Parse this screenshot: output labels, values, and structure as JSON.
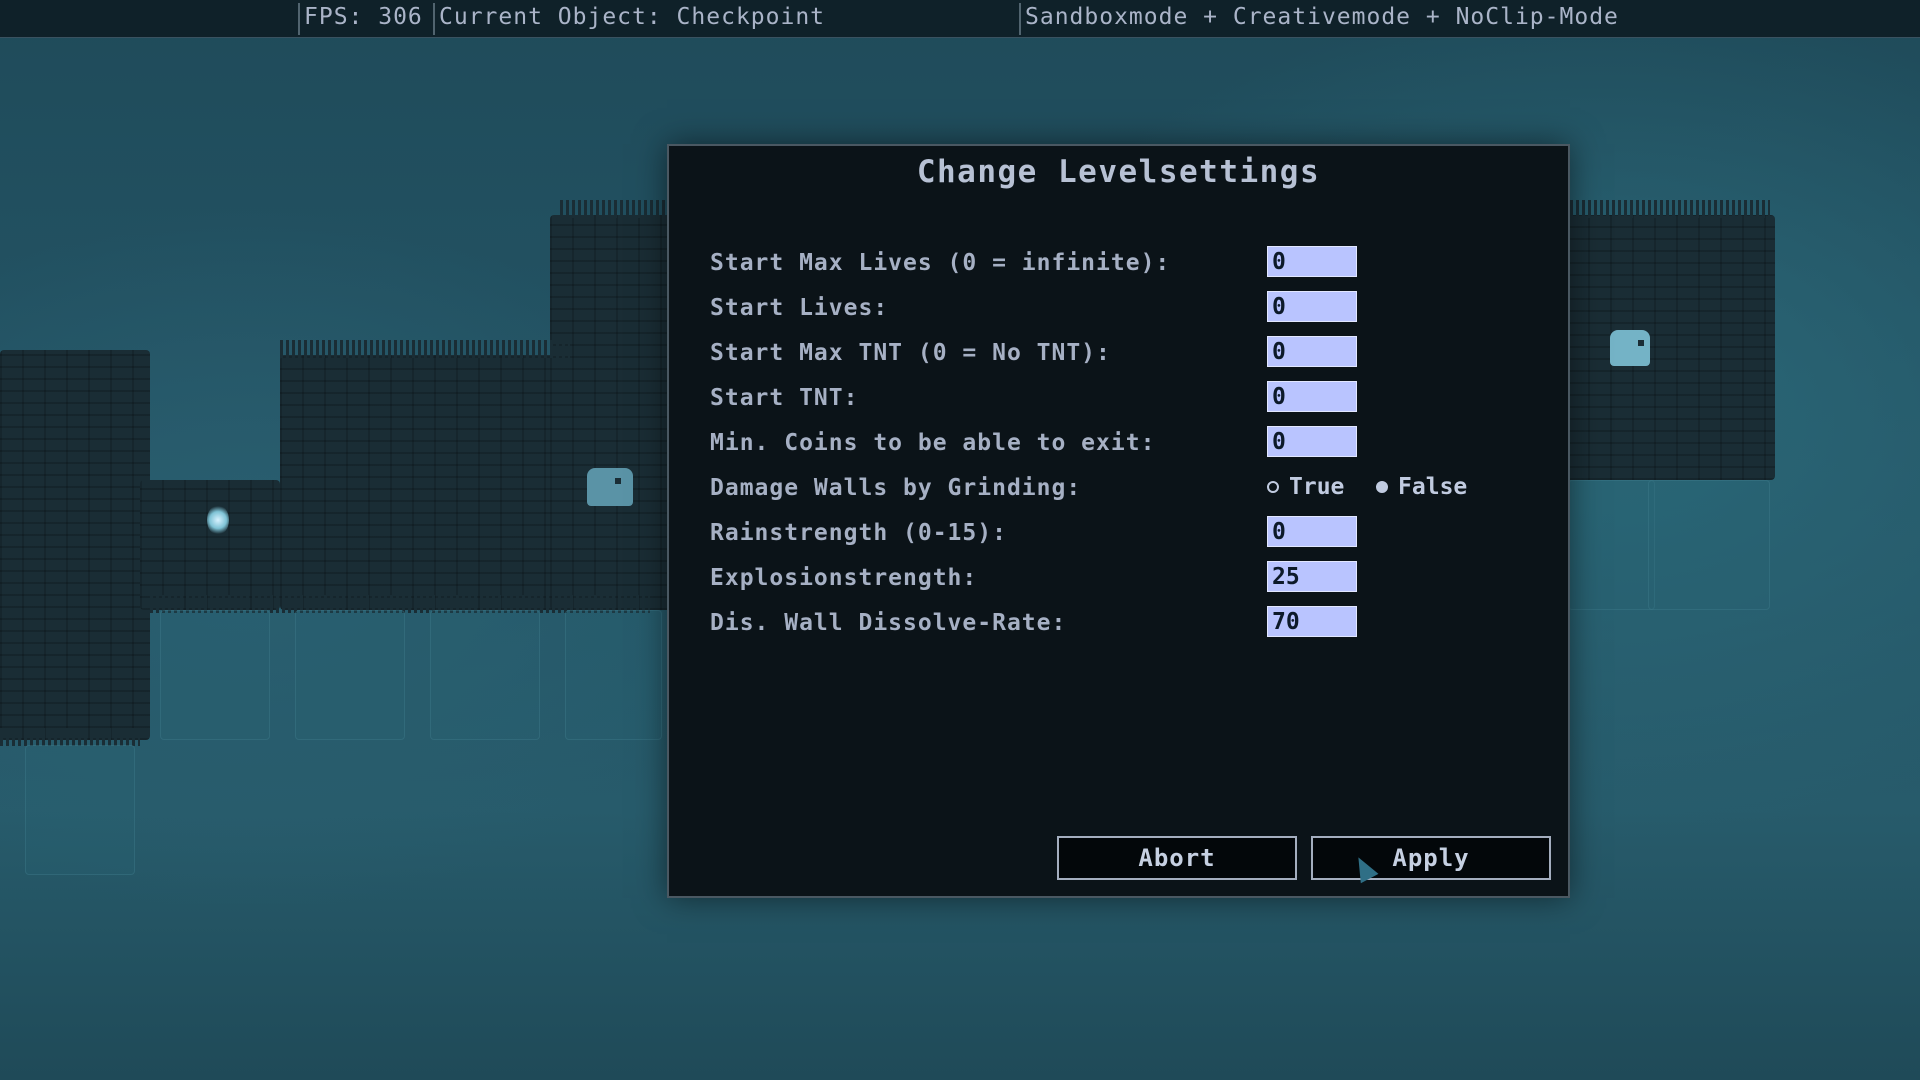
{
  "hud": {
    "fps": "FPS: 306",
    "current_object": "Current Object: Checkpoint",
    "modes": "Sandboxmode + Creativemode + NoClip-Mode"
  },
  "dialog": {
    "title": "Change Levelsettings",
    "fields": [
      {
        "label": "Start Max Lives (0 = infinite):",
        "value": "0"
      },
      {
        "label": "Start Lives:",
        "value": "0"
      },
      {
        "label": "Start Max TNT (0 = No TNT):",
        "value": "0"
      },
      {
        "label": "Start TNT:",
        "value": "0"
      },
      {
        "label": "Min. Coins to be able to exit:",
        "value": "0"
      },
      {
        "label": "Damage Walls by Grinding:",
        "options": [
          "True",
          "False"
        ],
        "selected": "False"
      },
      {
        "label": "Rainstrength (0-15):",
        "value": "0"
      },
      {
        "label": "Explosionstrength:",
        "value": "25"
      },
      {
        "label": "Dis. Wall Dissolve-Rate:",
        "value": "70"
      }
    ],
    "buttons": {
      "abort": "Abort",
      "apply": "Apply"
    }
  },
  "colors": {
    "background": "#245566",
    "dialog_bg": "#0b1318",
    "input_bg": "#b9c4ff",
    "text": "#a6b0c4"
  }
}
